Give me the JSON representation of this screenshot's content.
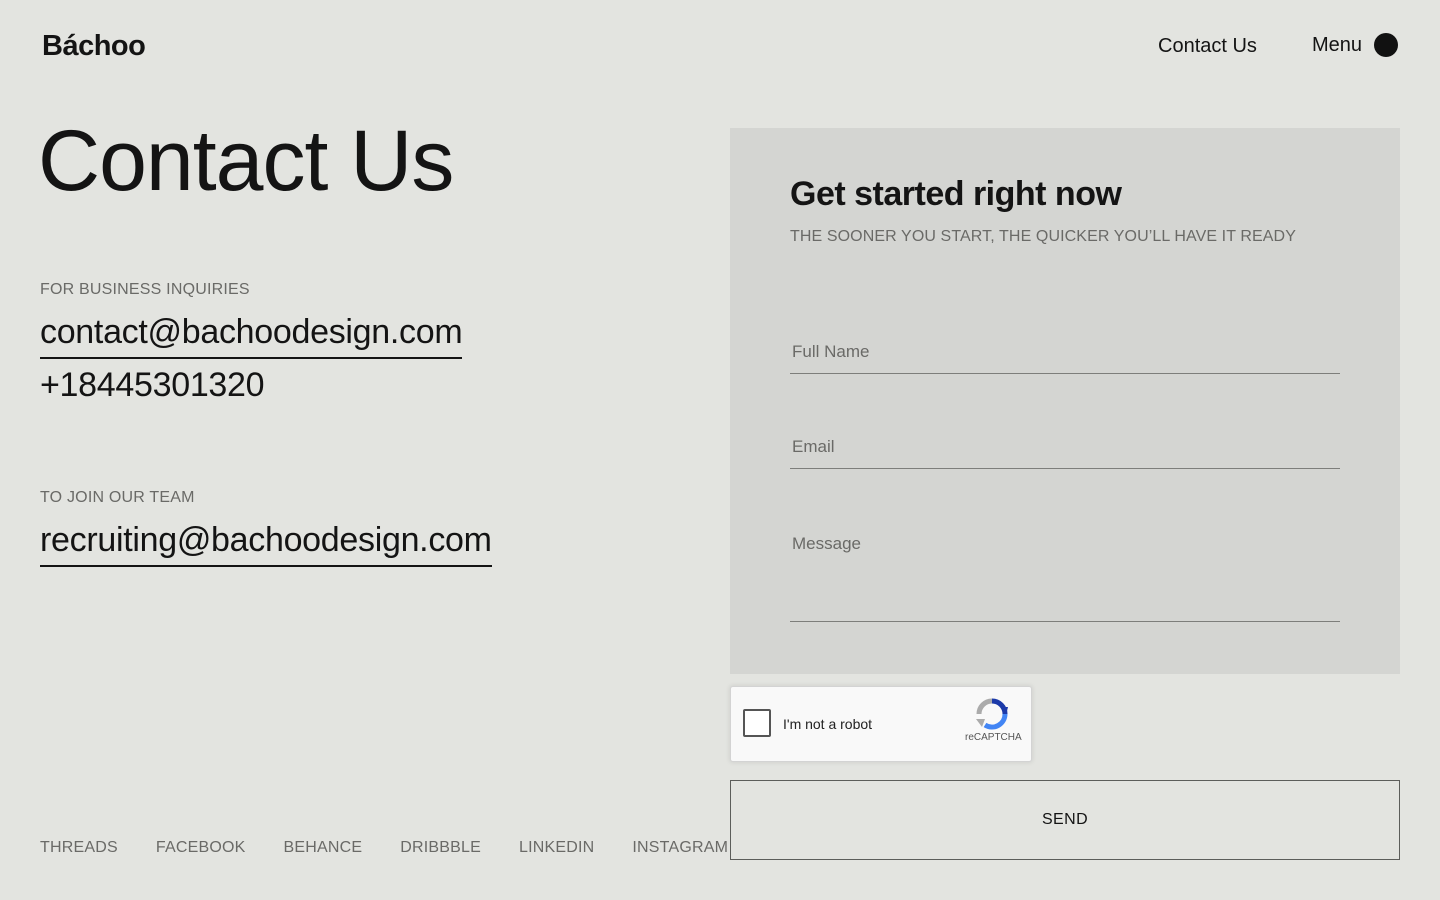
{
  "header": {
    "logo": "Báchoo",
    "nav_contact": "Contact Us",
    "menu_label": "Menu"
  },
  "main": {
    "title": "Contact Us",
    "business": {
      "label": "FOR BUSINESS INQUIRIES",
      "email": "contact@bachoodesign.com",
      "phone": "+18445301320"
    },
    "team": {
      "label": "TO JOIN OUR TEAM",
      "email": "recruiting@bachoodesign.com"
    }
  },
  "socials": [
    "THREADS",
    "FACEBOOK",
    "BEHANCE",
    "DRIBBBLE",
    "LINKEDIN",
    "INSTAGRAM"
  ],
  "form": {
    "title": "Get started right now",
    "subtitle": "THE SOONER YOU START, THE QUICKER YOU’LL HAVE IT READY",
    "fields": {
      "full_name_placeholder": "Full Name",
      "email_placeholder": "Email",
      "message_placeholder": "Message"
    },
    "captcha": {
      "label": "I'm not a robot",
      "brand": "reCAPTCHA"
    },
    "send_label": "SEND"
  },
  "colors": {
    "background": "#e3e4e0",
    "panel": "#d4d5d2",
    "text": "#141414",
    "muted": "#6a6a67"
  }
}
